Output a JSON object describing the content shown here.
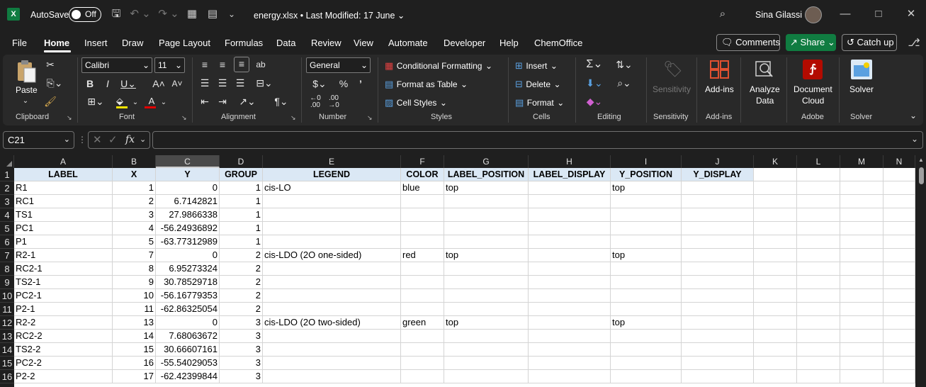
{
  "titlebar": {
    "autosave_label": "AutoSave",
    "autosave_state": "Off",
    "filename": "energy.xlsx",
    "separator": "•",
    "modified": "Last Modified: 17 June",
    "user": "Sina Gilassi"
  },
  "tabs": [
    "File",
    "Home",
    "Insert",
    "Draw",
    "Page Layout",
    "Formulas",
    "Data",
    "Review",
    "View",
    "Automate",
    "Developer",
    "Help",
    "ChemOffice"
  ],
  "actions": {
    "comments": "Comments",
    "share": "Share",
    "catchup": "Catch up"
  },
  "ribbon": {
    "clipboard": {
      "paste": "Paste",
      "label": "Clipboard"
    },
    "font": {
      "name": "Calibri",
      "size": "11",
      "label": "Font"
    },
    "alignment": {
      "label": "Alignment"
    },
    "number": {
      "format": "General",
      "label": "Number"
    },
    "styles": {
      "conditional": "Conditional Formatting",
      "table": "Format as Table",
      "cell": "Cell Styles",
      "label": "Styles"
    },
    "cells": {
      "insert": "Insert",
      "delete": "Delete",
      "format": "Format",
      "label": "Cells"
    },
    "editing": {
      "label": "Editing"
    },
    "sensitivity": {
      "button": "Sensitivity",
      "label": "Sensitivity"
    },
    "addins": {
      "button": "Add-ins",
      "label": "Add-ins"
    },
    "analyze": {
      "line1": "Analyze",
      "line2": "Data"
    },
    "adobe": {
      "line1": "Document",
      "line2": "Cloud",
      "label": "Adobe"
    },
    "solver": {
      "button": "Solver",
      "label": "Solver"
    }
  },
  "formula_bar": {
    "name_box": "C21",
    "fx": "fx",
    "content": ""
  },
  "columns": [
    "A",
    "B",
    "C",
    "D",
    "E",
    "F",
    "G",
    "H",
    "I",
    "J",
    "K",
    "L",
    "M",
    "N"
  ],
  "selected_column": "C",
  "rows": [
    [
      "LABEL",
      "X",
      "Y",
      "GROUP",
      "LEGEND",
      "COLOR",
      "LABEL_POSITION",
      "LABEL_DISPLAY",
      "Y_POSITION",
      "Y_DISPLAY"
    ],
    [
      "R1",
      "1",
      "0",
      "1",
      "cis-LO",
      "blue",
      "top",
      "",
      "top",
      ""
    ],
    [
      "RC1",
      "2",
      "6.7142821",
      "1",
      "",
      "",
      "",
      "",
      "",
      ""
    ],
    [
      "TS1",
      "3",
      "27.9866338",
      "1",
      "",
      "",
      "",
      "",
      "",
      ""
    ],
    [
      "PC1",
      "4",
      "-56.24936892",
      "1",
      "",
      "",
      "",
      "",
      "",
      ""
    ],
    [
      "P1",
      "5",
      "-63.77312989",
      "1",
      "",
      "",
      "",
      "",
      "",
      ""
    ],
    [
      "R2-1",
      "7",
      "0",
      "2",
      "cis-LDO (2O one-sided)",
      "red",
      "top",
      "",
      "top",
      ""
    ],
    [
      "RC2-1",
      "8",
      "6.95273324",
      "2",
      "",
      "",
      "",
      "",
      "",
      ""
    ],
    [
      "TS2-1",
      "9",
      "30.78529718",
      "2",
      "",
      "",
      "",
      "",
      "",
      ""
    ],
    [
      "PC2-1",
      "10",
      "-56.16779353",
      "2",
      "",
      "",
      "",
      "",
      "",
      ""
    ],
    [
      "P2-1",
      "11",
      "-62.86325054",
      "2",
      "",
      "",
      "",
      "",
      "",
      ""
    ],
    [
      "R2-2",
      "13",
      "0",
      "3",
      "cis-LDO (2O two-sided)",
      "green",
      "top",
      "",
      "top",
      ""
    ],
    [
      "RC2-2",
      "14",
      "7.68063672",
      "3",
      "",
      "",
      "",
      "",
      "",
      ""
    ],
    [
      "TS2-2",
      "15",
      "30.66607161",
      "3",
      "",
      "",
      "",
      "",
      "",
      ""
    ],
    [
      "PC2-2",
      "16",
      "-55.54029053",
      "3",
      "",
      "",
      "",
      "",
      "",
      ""
    ],
    [
      "P2-2",
      "17",
      "-62.42399844",
      "3",
      "",
      "",
      "",
      "",
      "",
      ""
    ]
  ],
  "row_numbers": [
    "1",
    "2",
    "3",
    "4",
    "5",
    "6",
    "7",
    "8",
    "9",
    "10",
    "11",
    "12",
    "13",
    "14",
    "15",
    "16"
  ],
  "colors": {
    "excel_green": "#107c41",
    "header_fill": "#dbe8f5",
    "pdf_red": "#b30b00"
  }
}
